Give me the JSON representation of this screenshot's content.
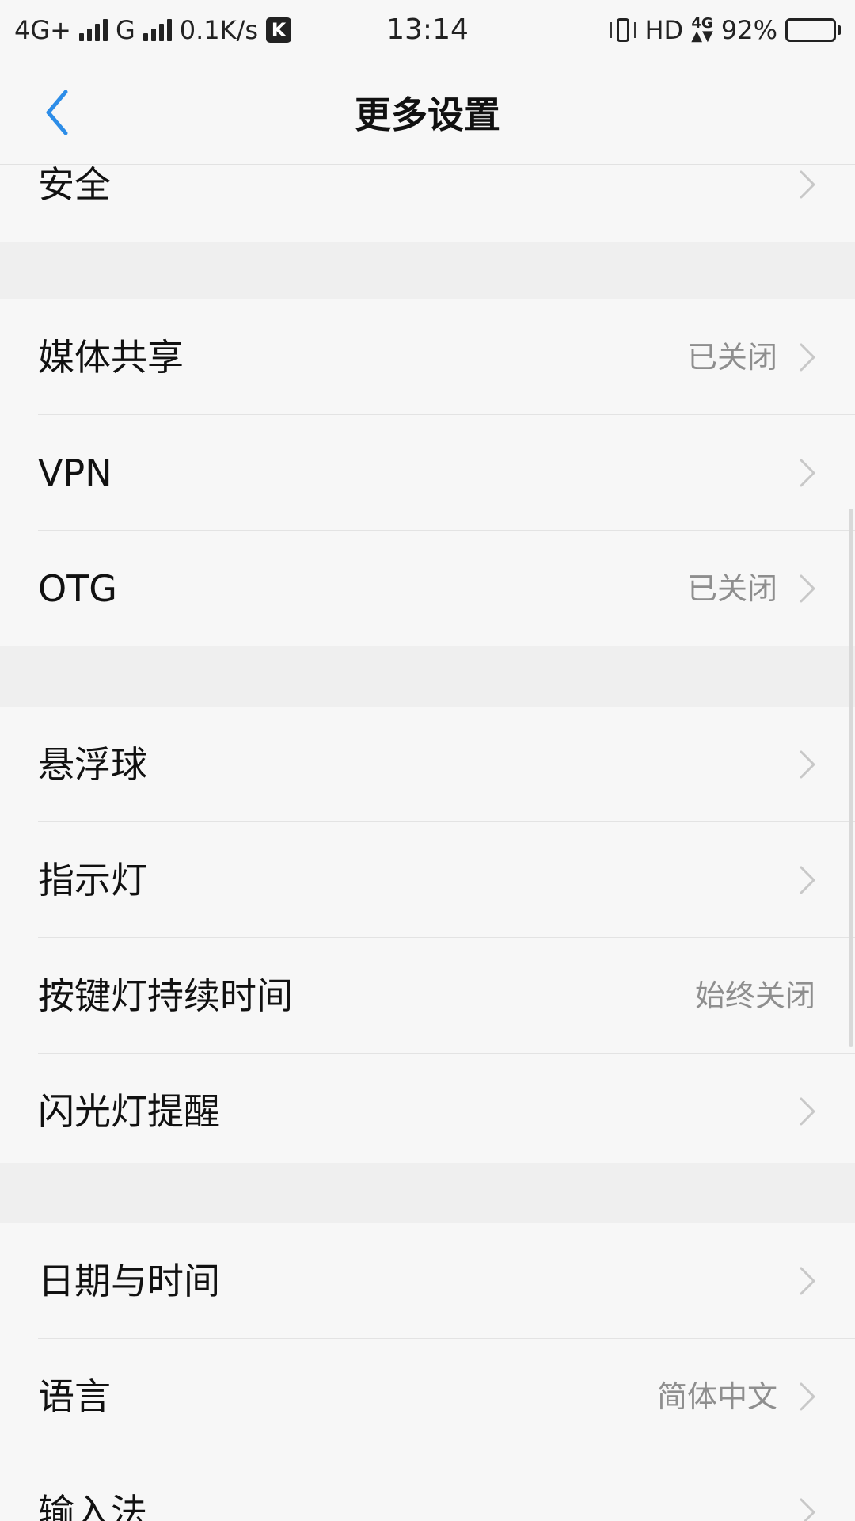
{
  "status_bar": {
    "network1": "4G+",
    "network2": "G",
    "speed": "0.1K/s",
    "k_icon": "K",
    "time": "13:14",
    "hd": "HD",
    "net4g_top": "4G",
    "net4g_bottom": "▲▼",
    "battery": "92%",
    "battery_level": 0.92
  },
  "header": {
    "title": "更多设置",
    "back_icon": "chevron-left",
    "accent_color": "#2d8de8"
  },
  "list": {
    "items": [
      {
        "label": "安全",
        "value": ""
      },
      {
        "label": "媒体共享",
        "value": "已关闭"
      },
      {
        "label": "VPN",
        "value": ""
      },
      {
        "label": "OTG",
        "value": "已关闭"
      },
      {
        "label": "悬浮球",
        "value": ""
      },
      {
        "label": "指示灯",
        "value": ""
      },
      {
        "label": "按键灯持续时间",
        "value": "始终关闭"
      },
      {
        "label": "闪光灯提醒",
        "value": ""
      },
      {
        "label": "日期与时间",
        "value": ""
      },
      {
        "label": "语言",
        "value": "简体中文"
      },
      {
        "label": "输入法",
        "value": ""
      }
    ]
  }
}
